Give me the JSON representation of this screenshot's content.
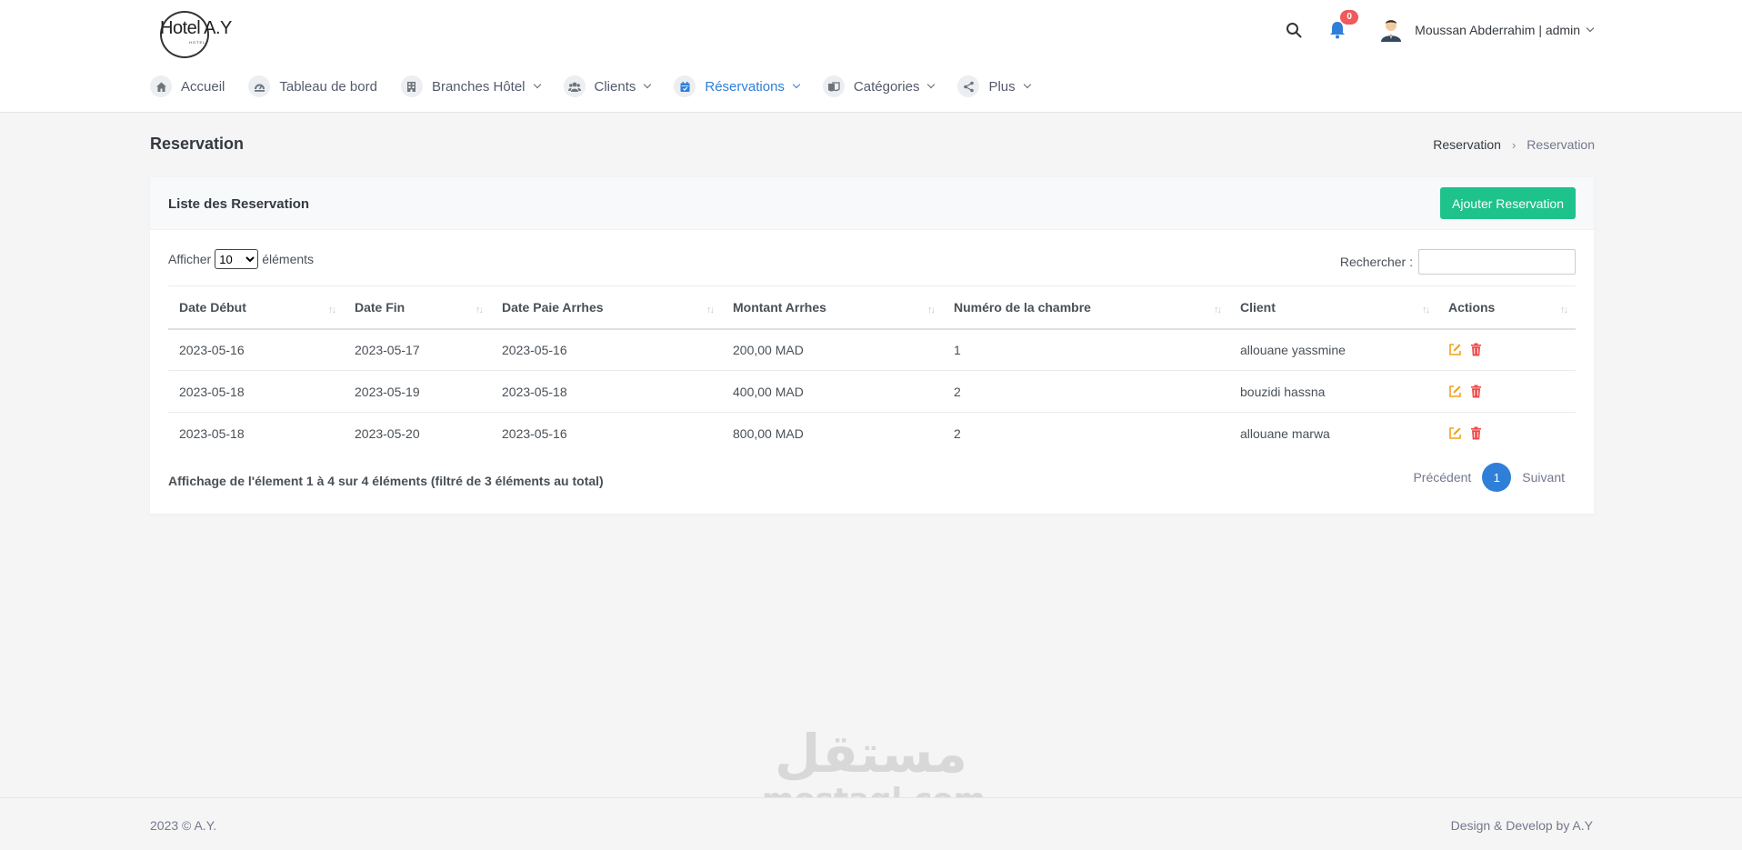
{
  "brand": {
    "logo_text": "Hotel A.Y",
    "logo_sub": "HOTEL"
  },
  "header": {
    "notification_count": "0",
    "user_name": "Moussan Abderrahim | admin"
  },
  "nav": {
    "items": [
      {
        "label": "Accueil",
        "icon": "home-icon"
      },
      {
        "label": "Tableau de bord",
        "icon": "dashboard-icon"
      },
      {
        "label": "Branches Hôtel",
        "icon": "building-icon"
      },
      {
        "label": "Clients",
        "icon": "users-icon"
      },
      {
        "label": "Réservations",
        "icon": "calendar-icon"
      },
      {
        "label": "Catégories",
        "icon": "category-icon"
      },
      {
        "label": "Plus",
        "icon": "share-icon"
      }
    ],
    "active": "Réservations"
  },
  "page": {
    "title": "Reservation",
    "breadcrumb": [
      "Reservation",
      "Reservation"
    ]
  },
  "card": {
    "title": "Liste des Reservation",
    "add_button": "Ajouter Reservation",
    "length_prefix": "Afficher",
    "length_value": "10",
    "length_suffix": "éléments",
    "search_label": "Rechercher :",
    "search_value": ""
  },
  "table": {
    "columns": [
      "Date Début",
      "Date Fin",
      "Date Paie Arrhes",
      "Montant Arrhes",
      "Numéro de la chambre",
      "Client",
      "Actions"
    ],
    "rows": [
      [
        "2023-05-16",
        "2023-05-17",
        "2023-05-16",
        "200,00 MAD",
        "1",
        "allouane yassmine"
      ],
      [
        "2023-05-18",
        "2023-05-19",
        "2023-05-18",
        "400,00 MAD",
        "2",
        "bouzidi hassna"
      ],
      [
        "2023-05-18",
        "2023-05-20",
        "2023-05-16",
        "800,00 MAD",
        "2",
        "allouane marwa"
      ]
    ]
  },
  "info_text": "Affichage de l'élement 1 à 4 sur 4 éléments (filtré de 3 éléments au total)",
  "pagination": {
    "prev": "Précédent",
    "current": "1",
    "next": "Suivant"
  },
  "watermark": {
    "arabic": "مستقل",
    "latin": "mostaql.com"
  },
  "footer": {
    "left": "2023 © A.Y.",
    "right": "Design & Develop by A.Y"
  },
  "colors": {
    "accent": "#2f7fd8",
    "add_button": "#1ec28b",
    "edit_icon": "#f1a21b",
    "delete_icon": "#f04848",
    "badge": "#f05a5a"
  }
}
